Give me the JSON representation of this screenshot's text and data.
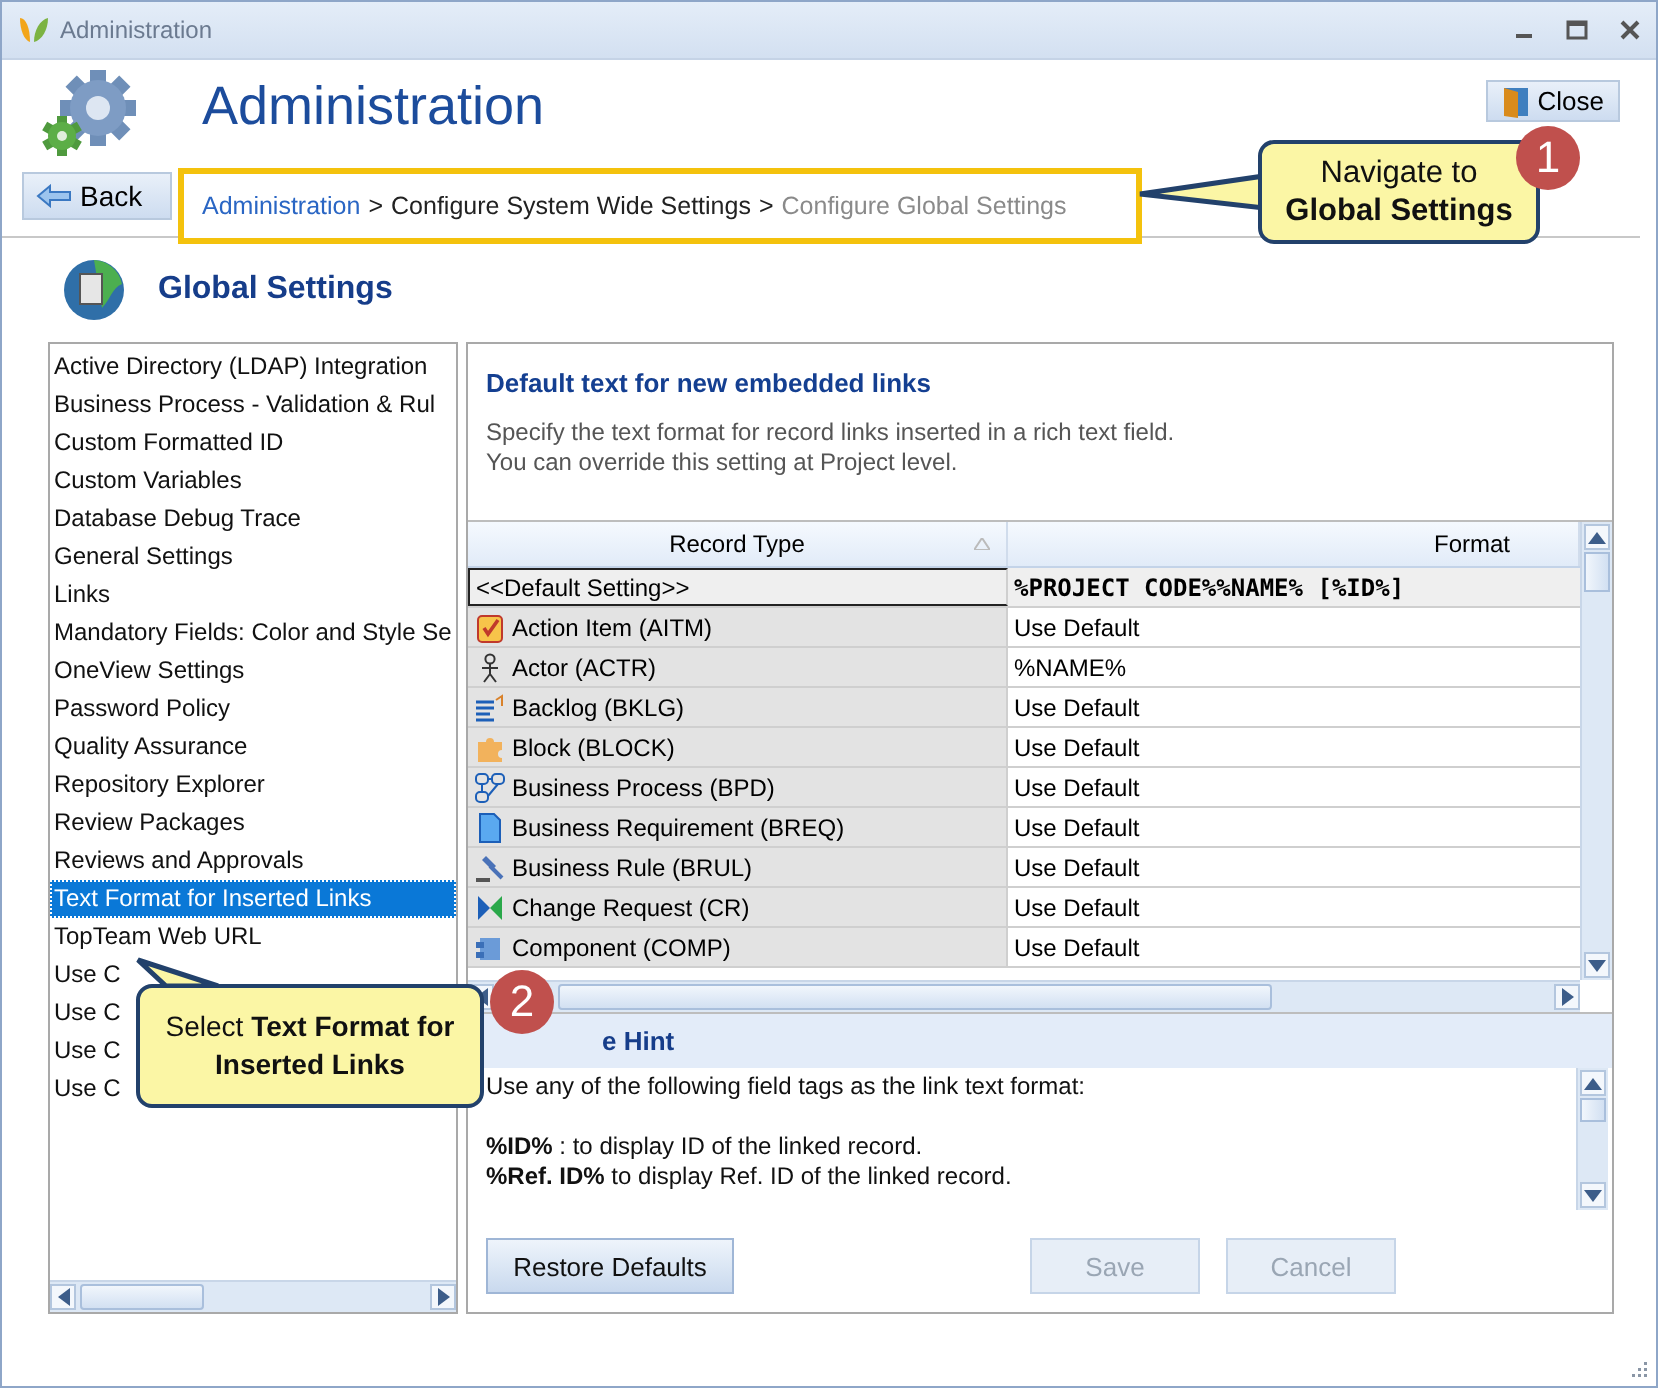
{
  "window": {
    "title": "Administration"
  },
  "header": {
    "title": "Administration",
    "close_button": "Close",
    "back_button": "Back"
  },
  "breadcrumb": [
    {
      "label": "Administration",
      "kind": "link"
    },
    {
      "label": ">",
      "kind": "separator"
    },
    {
      "label": "Configure System Wide Settings",
      "kind": "current"
    },
    {
      "label": ">",
      "kind": "separator"
    },
    {
      "label": "Configure Global Settings",
      "kind": "muted"
    }
  ],
  "section_title": "Global Settings",
  "settings_list": [
    {
      "label": "Active Directory (LDAP) Integration",
      "selected": false
    },
    {
      "label": "Business Process - Validation & Rul",
      "selected": false
    },
    {
      "label": "Custom Formatted ID",
      "selected": false
    },
    {
      "label": "Custom Variables",
      "selected": false
    },
    {
      "label": "Database Debug Trace",
      "selected": false
    },
    {
      "label": "General Settings",
      "selected": false
    },
    {
      "label": "Links",
      "selected": false
    },
    {
      "label": "Mandatory Fields: Color and Style Se",
      "selected": false
    },
    {
      "label": "OneView Settings",
      "selected": false
    },
    {
      "label": "Password Policy",
      "selected": false
    },
    {
      "label": "Quality Assurance",
      "selected": false
    },
    {
      "label": "Repository Explorer",
      "selected": false
    },
    {
      "label": "Review Packages",
      "selected": false
    },
    {
      "label": "Reviews and Approvals",
      "selected": false
    },
    {
      "label": "Text Format for Inserted Links",
      "selected": true
    },
    {
      "label": "TopTeam Web URL",
      "selected": false
    },
    {
      "label": "Use C",
      "selected": false
    },
    {
      "label": "Use C",
      "selected": false
    },
    {
      "label": "Use C",
      "selected": false
    },
    {
      "label": "Use C",
      "selected": false
    }
  ],
  "detail": {
    "title": "Default text for new embedded links",
    "description": [
      "Specify the text format for record links inserted in a rich text field.",
      "You can override this setting at Project level."
    ]
  },
  "table": {
    "columns": [
      "Record Type",
      "Format"
    ],
    "rows": [
      {
        "record_type": "<<Default Setting>>",
        "format": "%PROJECT CODE%%NAME% [%ID%]",
        "kind": "default"
      },
      {
        "record_type": "Action Item (AITM)",
        "format": "Use Default",
        "kind": "record"
      },
      {
        "record_type": "Actor (ACTR)",
        "format": "%NAME%",
        "kind": "record"
      },
      {
        "record_type": "Backlog (BKLG)",
        "format": "Use Default",
        "kind": "record"
      },
      {
        "record_type": "Block (BLOCK)",
        "format": "Use Default",
        "kind": "record"
      },
      {
        "record_type": "Business Process (BPD)",
        "format": "Use Default",
        "kind": "record"
      },
      {
        "record_type": "Business Requirement (BREQ)",
        "format": "Use Default",
        "kind": "record"
      },
      {
        "record_type": "Business Rule (BRUL)",
        "format": "Use Default",
        "kind": "record"
      },
      {
        "record_type": "Change Request (CR)",
        "format": "Use Default",
        "kind": "record"
      },
      {
        "record_type": "Component (COMP)",
        "format": "Use Default",
        "kind": "record"
      }
    ]
  },
  "hint": {
    "title": "e Hint",
    "lines": [
      "Use any of the following field tags as the link text format:",
      "**%ID%** : to display ID of the linked record.",
      "**%Ref. ID%** to display Ref. ID of the linked record."
    ]
  },
  "buttons": [
    {
      "label": "Restore Defaults",
      "disabled": false
    },
    {
      "label": "Save",
      "disabled": true
    },
    {
      "label": "Cancel",
      "disabled": true
    }
  ],
  "callouts": [
    {
      "number": "1",
      "text": "Navigate to\n**Global Settings**"
    },
    {
      "number": "2",
      "text": "Select **Text Format for**\n**Inserted Links**"
    }
  ]
}
